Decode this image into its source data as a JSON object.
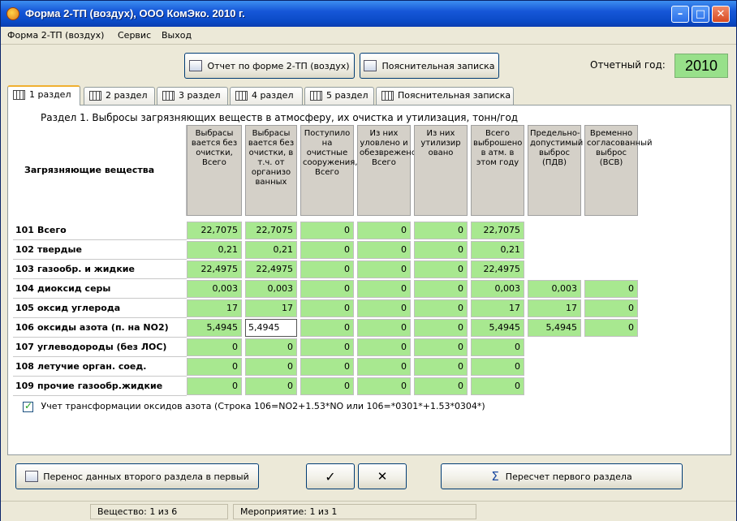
{
  "window": {
    "title": "Форма 2-ТП (воздух), ООО КомЭко. 2010 г."
  },
  "menu": [
    "Форма 2-ТП (воздух)",
    "Сервис",
    "Выход"
  ],
  "toolbar": {
    "report_btn": "Отчет по форме 2-ТП (воздух)",
    "note_btn": "Пояснительная записка",
    "year_label": "Отчетный год:",
    "year_value": "2010"
  },
  "tabs": [
    "1 раздел",
    "2 раздел",
    "3 раздел",
    "4 раздел",
    "5 раздел",
    "Пояснительная записка"
  ],
  "section": {
    "title": "Раздел 1. Выбросы загрязняющих веществ в атмосферу, их очистка и утилизация, тонн/год",
    "substance_header": "Загрязняющие вещества",
    "column_headers": [
      "Выбрасы вается без очистки, Всего",
      "Выбрасы вается без очистки, в т.ч. от организо ванных",
      "Поступило на очистные сооружения, Всего",
      "Из них уловлено и обезврежено, Всего",
      "Из них утилизир овано",
      "Всего выброшено в атм. в этом году",
      "Предельно-допустимый выброс (ПДВ)",
      "Временно согласованный выброс (ВСВ)"
    ],
    "rows": [
      {
        "num": "101",
        "name": "Всего",
        "values": [
          "22,7075",
          "22,7075",
          "0",
          "0",
          "0",
          "22,7075",
          "",
          ""
        ]
      },
      {
        "num": "102",
        "name": "твердые",
        "values": [
          "0,21",
          "0,21",
          "0",
          "0",
          "0",
          "0,21",
          "",
          ""
        ]
      },
      {
        "num": "103",
        "name": "газообр. и жидкие",
        "values": [
          "22,4975",
          "22,4975",
          "0",
          "0",
          "0",
          "22,4975",
          "",
          ""
        ]
      },
      {
        "num": "104",
        "name": "диоксид серы",
        "values": [
          "0,003",
          "0,003",
          "0",
          "0",
          "0",
          "0,003",
          "0,003",
          "0"
        ]
      },
      {
        "num": "105",
        "name": "оксид углерода",
        "values": [
          "17",
          "17",
          "0",
          "0",
          "0",
          "17",
          "17",
          "0"
        ]
      },
      {
        "num": "106",
        "name": "оксиды азота (п. на NO2)",
        "values": [
          "5,4945",
          "5,4945",
          "0",
          "0",
          "0",
          "5,4945",
          "5,4945",
          "0"
        ]
      },
      {
        "num": "107",
        "name": "углеводороды (без ЛОС)",
        "values": [
          "0",
          "0",
          "0",
          "0",
          "0",
          "0",
          "",
          ""
        ]
      },
      {
        "num": "108",
        "name": "летучие орган. соед.",
        "values": [
          "0",
          "0",
          "0",
          "0",
          "0",
          "0",
          "",
          ""
        ]
      },
      {
        "num": "109",
        "name": "прочие газообр.жидкие",
        "values": [
          "0",
          "0",
          "0",
          "0",
          "0",
          "0",
          "",
          ""
        ]
      }
    ],
    "checkbox_label": "Учет трансформации оксидов азота (Строка 106=NO2+1.53*NO или 106=*0301*+1.53*0304*)"
  },
  "bottom": {
    "transfer_btn": "Перенос данных второго раздела в первый",
    "ok_icon": "✓",
    "cancel_icon": "✕",
    "recalc_btn": "Пересчет первого раздела"
  },
  "status": {
    "substance": "Вещество: 1 из 6",
    "measure": "Мероприятие: 1 из 1"
  }
}
